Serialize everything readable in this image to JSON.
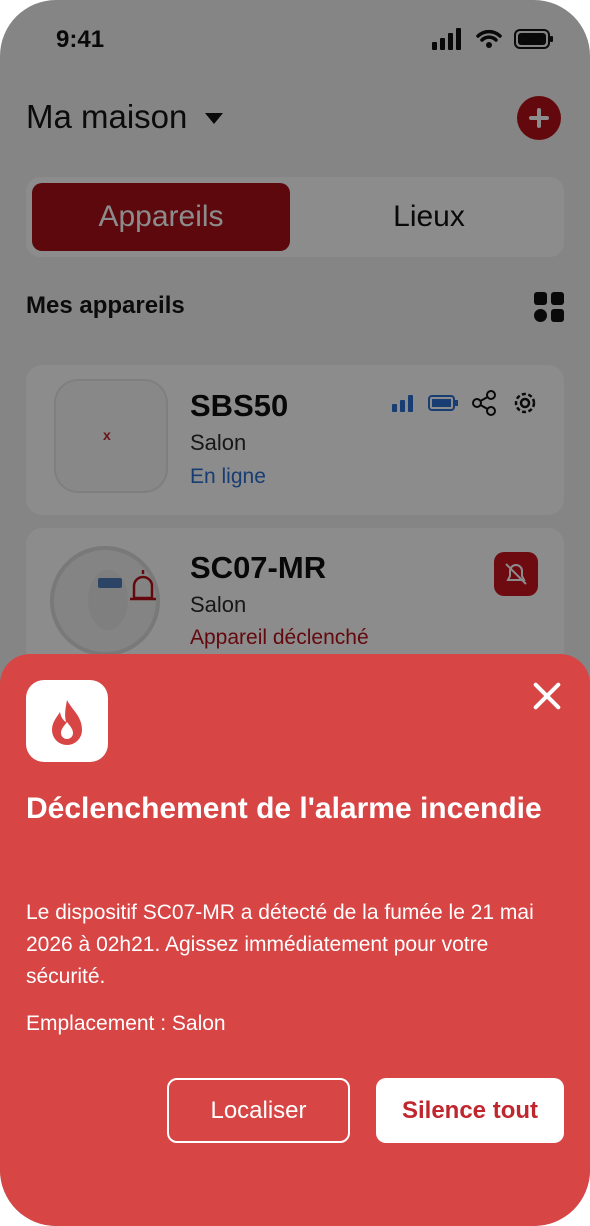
{
  "status_bar": {
    "time": "9:41"
  },
  "header": {
    "home_name": "Ma maison"
  },
  "segment": {
    "devices": "Appareils",
    "places": "Lieux"
  },
  "section": {
    "title": "Mes appareils"
  },
  "devices": [
    {
      "name": "SBS50",
      "location": "Salon",
      "status": "En ligne"
    },
    {
      "name": "SC07-MR",
      "location": "Salon",
      "status": "Appareil déclenché"
    }
  ],
  "alert": {
    "title": "Déclenchement de l'alarme incendie",
    "message": "Le dispositif SC07-MR a détecté de la fumée le 21 mai 2026 à 02h21. Agissez immédiatement pour votre sécurité.",
    "location": "Emplacement : Salon",
    "locate_label": "Localiser",
    "silence_label": "Silence tout"
  },
  "colors": {
    "brand": "#b5121b",
    "sheet": "#d74545",
    "online": "#2a6fd2"
  },
  "icons": [
    "signal-icon",
    "wifi-icon",
    "battery-icon",
    "chevron-down-icon",
    "plus-icon",
    "grid-icon",
    "share-icon",
    "settings-icon",
    "bell-off-icon",
    "siren-icon",
    "fire-icon",
    "close-icon"
  ]
}
